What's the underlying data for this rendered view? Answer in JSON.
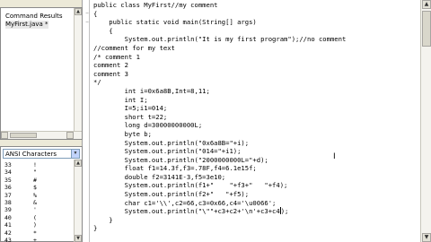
{
  "sidebar": {
    "tree_items": [
      "Command Results",
      "MyFirst.java *"
    ]
  },
  "charmap": {
    "selected": "ANSI Characters",
    "rows": [
      {
        "num": "33",
        "glyph": "!"
      },
      {
        "num": "34",
        "glyph": "\""
      },
      {
        "num": "35",
        "glyph": "#"
      },
      {
        "num": "36",
        "glyph": "$"
      },
      {
        "num": "37",
        "glyph": "%"
      },
      {
        "num": "38",
        "glyph": "&"
      },
      {
        "num": "39",
        "glyph": "'"
      },
      {
        "num": "40",
        "glyph": "("
      },
      {
        "num": "41",
        "glyph": ")"
      },
      {
        "num": "42",
        "glyph": "*"
      },
      {
        "num": "43",
        "glyph": "+"
      }
    ]
  },
  "editor": {
    "lines": [
      "public class MyFirst//my comment",
      "{",
      "    public static void main(String[] args)",
      "    {",
      "        System.out.println(\"It is my first program\");//no comment",
      "//comment for my text",
      "/* comment 1",
      "comment 2",
      "comment 3",
      "*/",
      "        int i=0x6a8B,Int=8,11;",
      "        int I;",
      "        I=5;i1=014;",
      "        short t=22;",
      "        long d=30000000000L;",
      "        byte b;",
      "        System.out.println(\"0x6a8B=\"+i);",
      "        System.out.println(\"014=\"+i1);",
      "        System.out.println(\"2000000000L=\"+d);",
      "        float f1=14.3f,f3=.78F,f4=6.1e15f;",
      "        double f2=3141E-3,f5=3e10;",
      "        System.out.println(f1+\"    \"+f3+\"   \"+f4);",
      "        System.out.println(f2+\"   \"+f5);",
      "        char c1='\\\\',c2=66,c3=0x66,c4='\\u0066';",
      "        System.out.println(\"\\\"\"+c3+c2+'\\n'+c3+c4",
      "    }",
      "}"
    ],
    "last_line_tail": ");"
  }
}
